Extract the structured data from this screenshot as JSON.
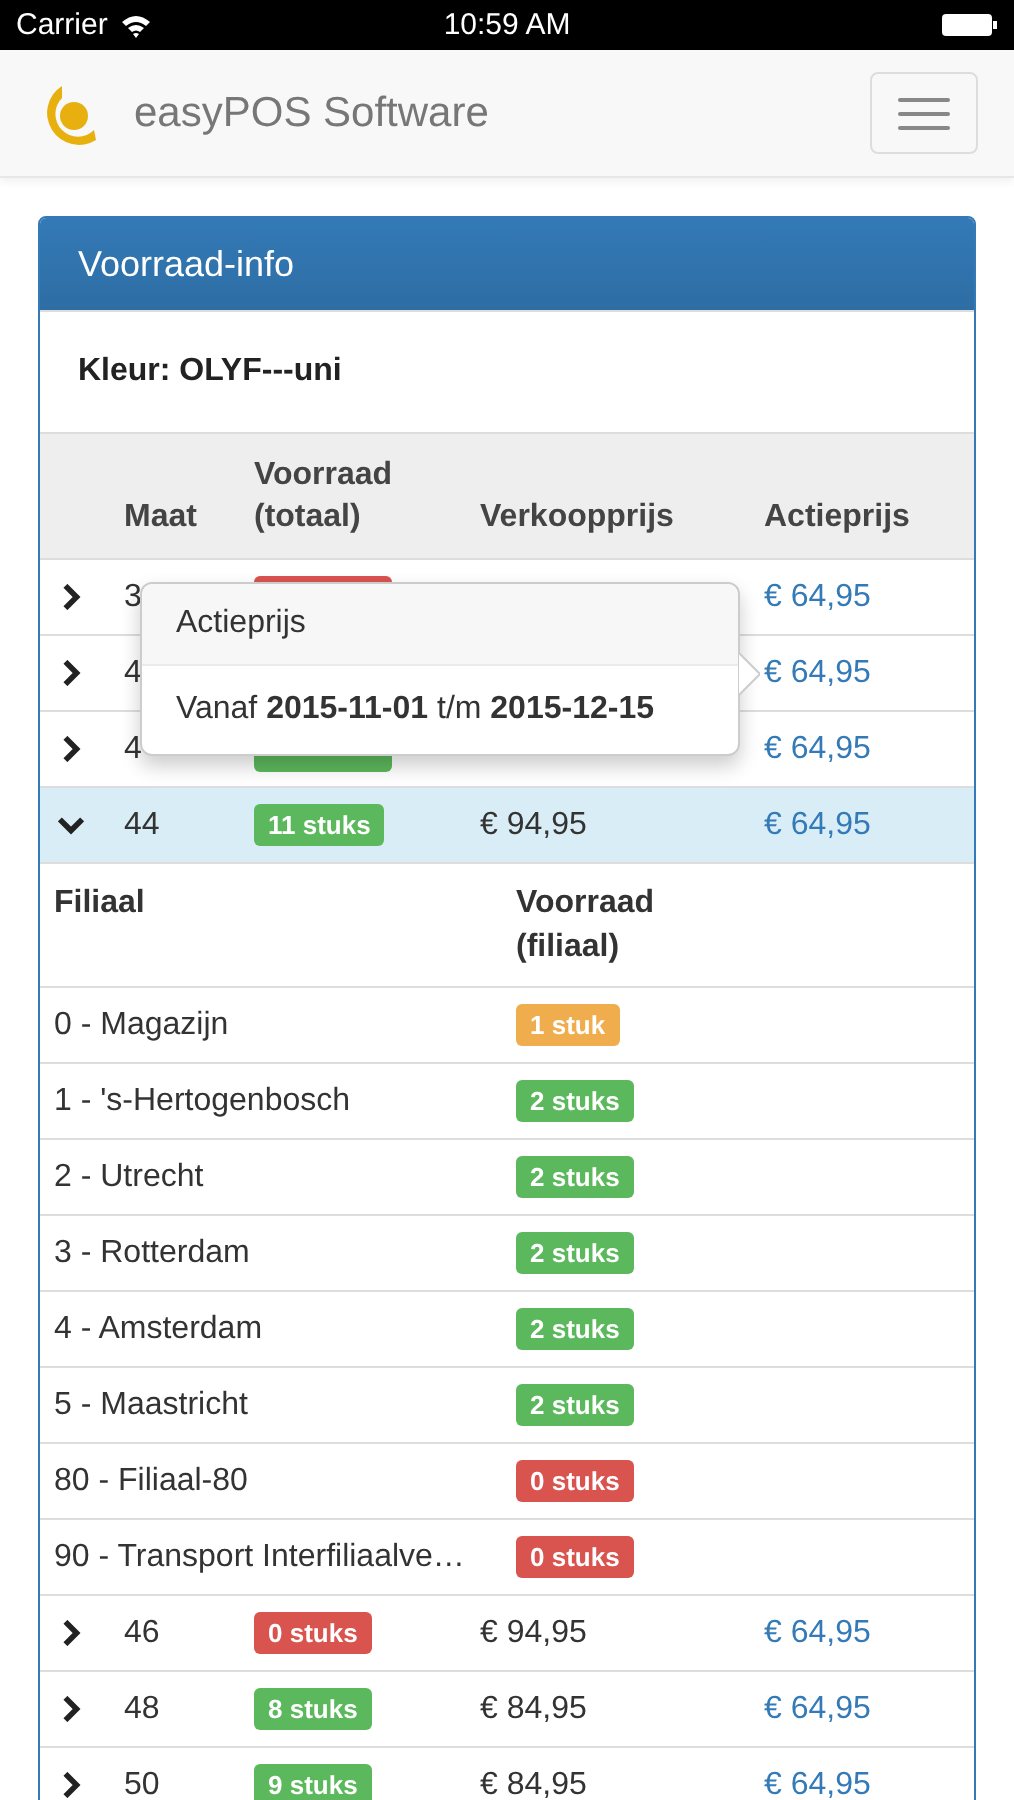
{
  "status_bar": {
    "carrier": "Carrier",
    "time": "10:59 AM"
  },
  "navbar": {
    "brand": "easyPOS Software"
  },
  "panel": {
    "title": "Voorraad-info",
    "color_label": "Kleur: OLYF---uni",
    "columns": [
      "Maat",
      "Voorraad (totaal)",
      "Verkoopprijs",
      "Actieprijs"
    ],
    "rows": [
      {
        "expanded": false,
        "size": "3",
        "stock": {
          "color": "#d9534f"
        },
        "sale_price": "€ 64,95"
      },
      {
        "expanded": false,
        "size": "4",
        "sale_price": "€ 64,95"
      },
      {
        "expanded": false,
        "size": "4",
        "stock": {
          "color": "#5cb85c"
        },
        "sale_price": "€ 64,95"
      },
      {
        "expanded": true,
        "size": "44",
        "stock": {
          "text": "11 stuks",
          "color": "#5cb85c"
        },
        "price": "€ 94,95",
        "sale_price": "€ 64,95",
        "branch_columns": [
          "Filiaal",
          "Voorraad (filiaal)"
        ],
        "branches": [
          {
            "name": "0 - Magazijn",
            "stock": {
              "text": "1 stuk",
              "color": "#f0ad4e"
            }
          },
          {
            "name": "1 - 's-Hertogenbosch",
            "stock": {
              "text": "2 stuks",
              "color": "#5cb85c"
            }
          },
          {
            "name": "2 - Utrecht",
            "stock": {
              "text": "2 stuks",
              "color": "#5cb85c"
            }
          },
          {
            "name": "3 - Rotterdam",
            "stock": {
              "text": "2 stuks",
              "color": "#5cb85c"
            }
          },
          {
            "name": "4 - Amsterdam",
            "stock": {
              "text": "2 stuks",
              "color": "#5cb85c"
            }
          },
          {
            "name": "5 - Maastricht",
            "stock": {
              "text": "2 stuks",
              "color": "#5cb85c"
            }
          },
          {
            "name": "80 - Filiaal-80",
            "stock": {
              "text": "0 stuks",
              "color": "#d9534f"
            }
          },
          {
            "name": "90 - Transport Interfiliaalve…",
            "stock": {
              "text": "0 stuks",
              "color": "#d9534f"
            }
          }
        ]
      },
      {
        "expanded": false,
        "size": "46",
        "stock": {
          "text": "0 stuks",
          "color": "#d9534f"
        },
        "price": "€ 94,95",
        "sale_price": "€ 64,95"
      },
      {
        "expanded": false,
        "size": "48",
        "stock": {
          "text": "8 stuks",
          "color": "#5cb85c"
        },
        "price": "€ 84,95",
        "sale_price": "€ 64,95"
      },
      {
        "expanded": false,
        "size": "50",
        "stock": {
          "text": "9 stuks",
          "color": "#5cb85c"
        },
        "price": "€ 84,95",
        "sale_price": "€ 64,95"
      }
    ]
  },
  "popover": {
    "title": "Actieprijs",
    "body": "Vanaf **2015-11-01** t/m **2015-12-15**"
  }
}
